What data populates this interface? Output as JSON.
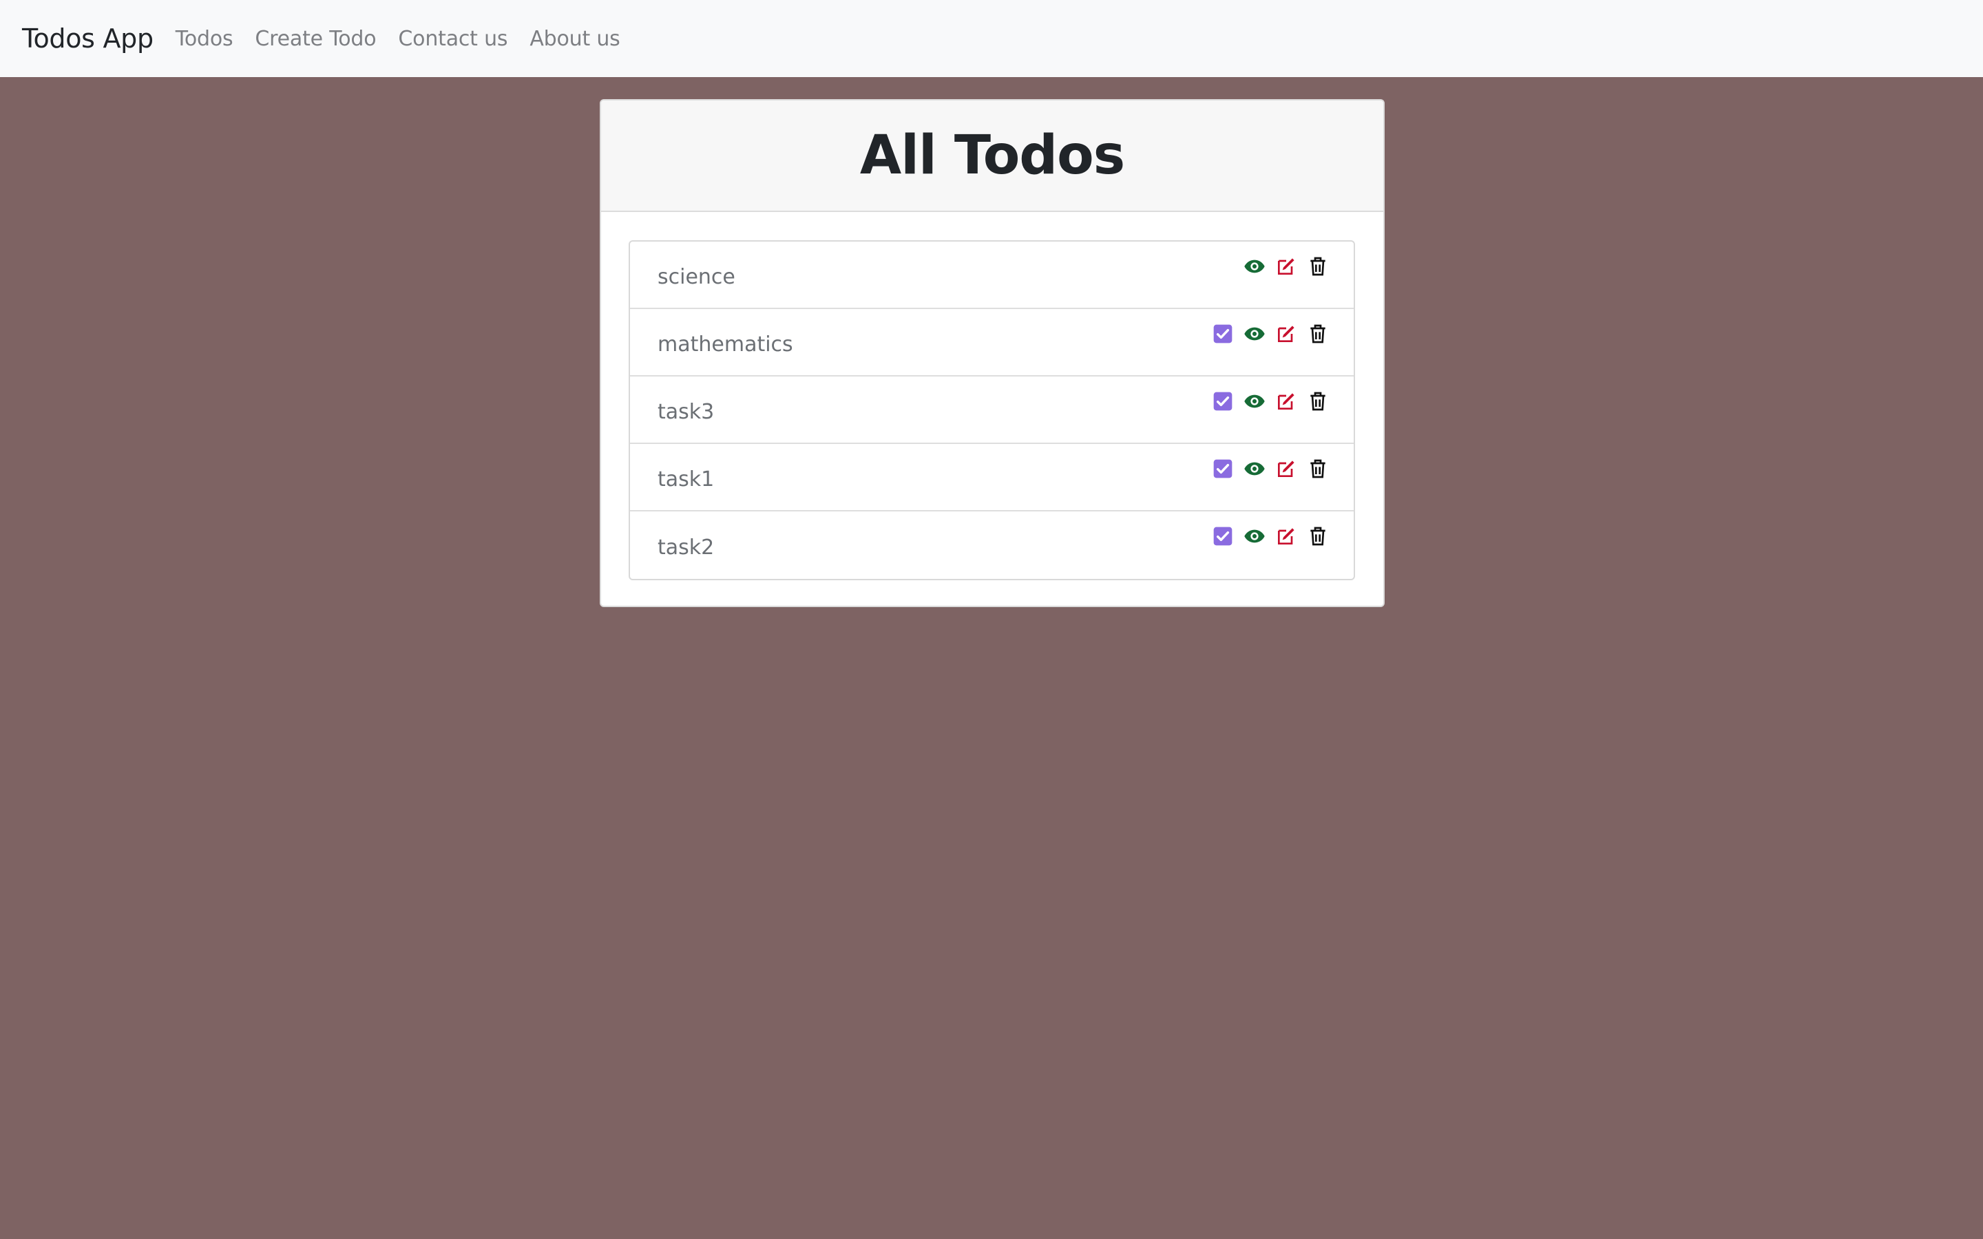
{
  "navbar": {
    "brand": "Todos App",
    "links": [
      "Todos",
      "Create Todo",
      "Contact us",
      "About us"
    ]
  },
  "card": {
    "title": "All Todos"
  },
  "todos": [
    {
      "title": "science",
      "completed": false
    },
    {
      "title": "mathematics",
      "completed": true
    },
    {
      "title": "task3",
      "completed": true
    },
    {
      "title": "task1",
      "completed": true
    },
    {
      "title": "task2",
      "completed": true
    }
  ],
  "icons": {
    "check": "check-square-icon",
    "view": "eye-icon",
    "edit": "edit-icon",
    "delete": "trash-icon"
  },
  "colors": {
    "background": "#7e6363",
    "navbar": "#f8f9fa",
    "check": "#8a6be0",
    "view": "#166b36",
    "edit": "#c8102e",
    "delete": "#111111"
  }
}
